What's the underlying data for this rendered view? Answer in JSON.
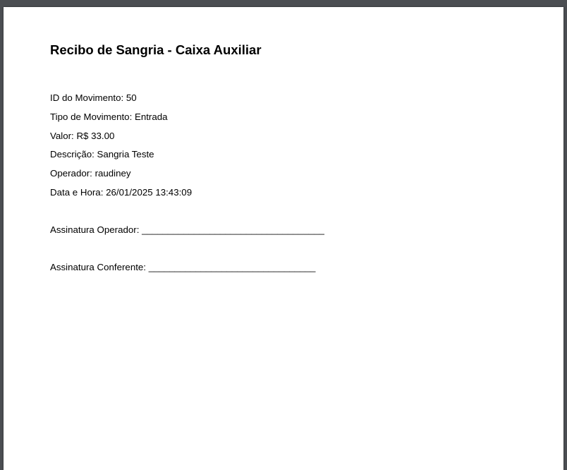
{
  "document": {
    "title": "Recibo de Sangria - Caixa Auxiliar",
    "fields": [
      "ID do Movimento: 50",
      "Tipo de Movimento: Entrada",
      "Valor: R$ 33.00",
      "Descrição: Sangria Teste",
      "Operador: raudiney",
      "Data e Hora: 26/01/2025 13:43:09"
    ],
    "signatures": {
      "operator": "Assinatura Operador: ___________________________________",
      "checker": "Assinatura Conferente: ________________________________"
    }
  }
}
